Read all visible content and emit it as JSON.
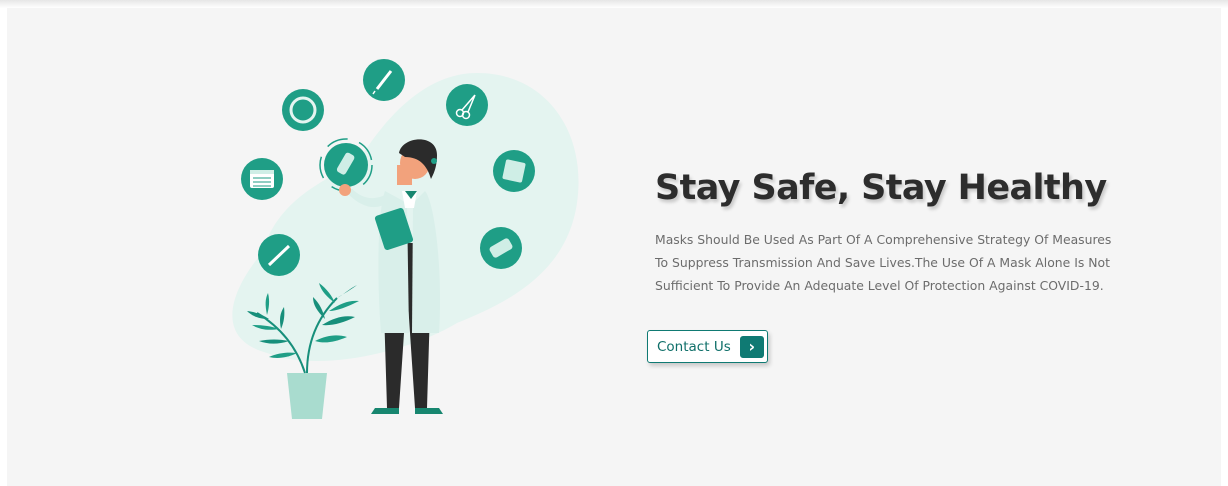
{
  "hero": {
    "title": "Stay Safe, Stay Healthy",
    "description": "Masks Should Be Used As Part Of A Comprehensive Strategy Of Measures To Suppress Transmission And Save Lives.The Use Of A Mask Alone Is Not Sufficient To Provide An Adequate Level Of Protection Against COVID-19.",
    "cta_label": "Contact Us",
    "cta_icon": "chevron-right-icon"
  },
  "illustration": {
    "subject": "doctor-with-clipboard",
    "icons": [
      "syringe-icon",
      "scissors-icon",
      "bandage-icon",
      "pills-icon",
      "thermometer-icon",
      "calendar-icon",
      "pill-bottle-icon",
      "stethoscope-icon"
    ]
  },
  "colors": {
    "accent": "#0f7a73",
    "icon_circle": "#1f9e86",
    "blob": "#e4f4f0",
    "title": "#2d2d2d",
    "text": "#6c6c6c",
    "background": "#f5f5f5"
  }
}
